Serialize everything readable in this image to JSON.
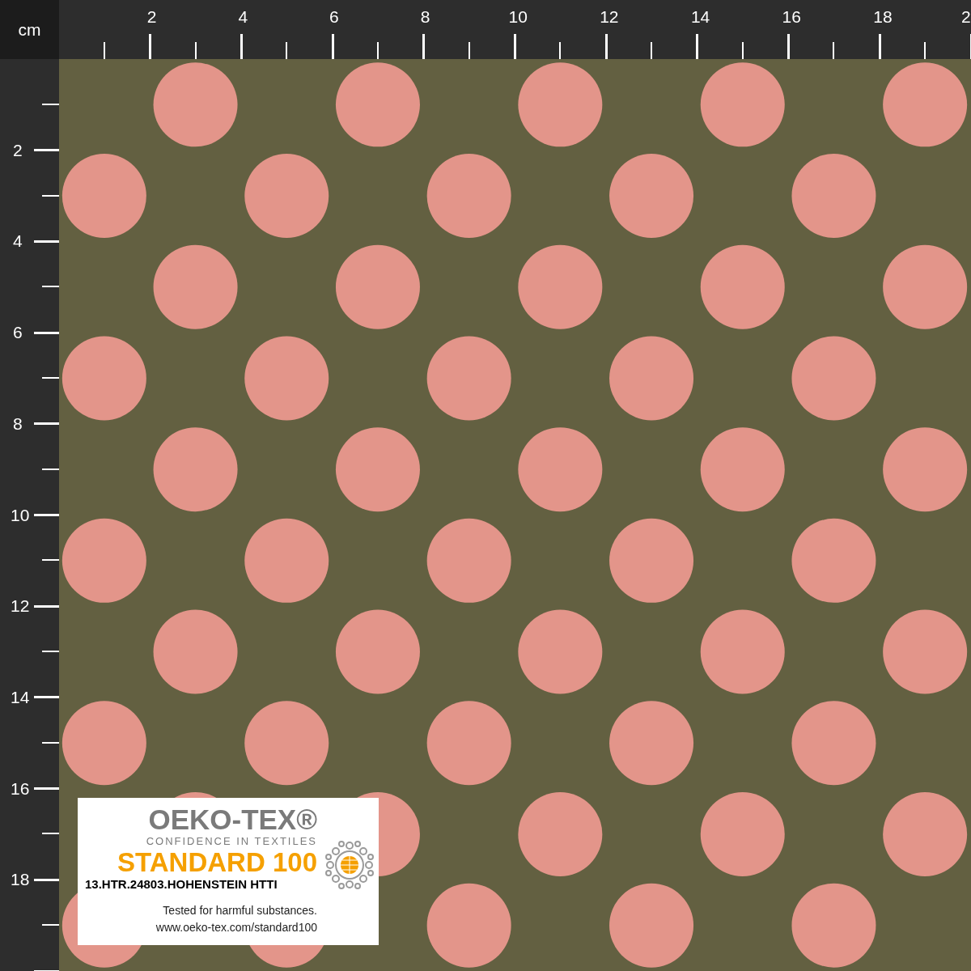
{
  "ruler": {
    "unit": "cm",
    "top_labels": [
      "2",
      "4",
      "6",
      "8",
      "10",
      "12",
      "14",
      "16",
      "18",
      "2"
    ],
    "left_labels": [
      "2",
      "4",
      "6",
      "8",
      "10",
      "12",
      "14",
      "16",
      "18"
    ]
  },
  "certificate_label": {
    "brand": "OEKO-TEX®",
    "tagline": "CONFIDENCE IN TEXTILES",
    "standard": "STANDARD 100",
    "certificate_number": "13.HTR.24803.HOHENSTEIN HTTI",
    "note": "Tested for harmful substances.",
    "url": "www.oeko-tex.com/standard100"
  }
}
